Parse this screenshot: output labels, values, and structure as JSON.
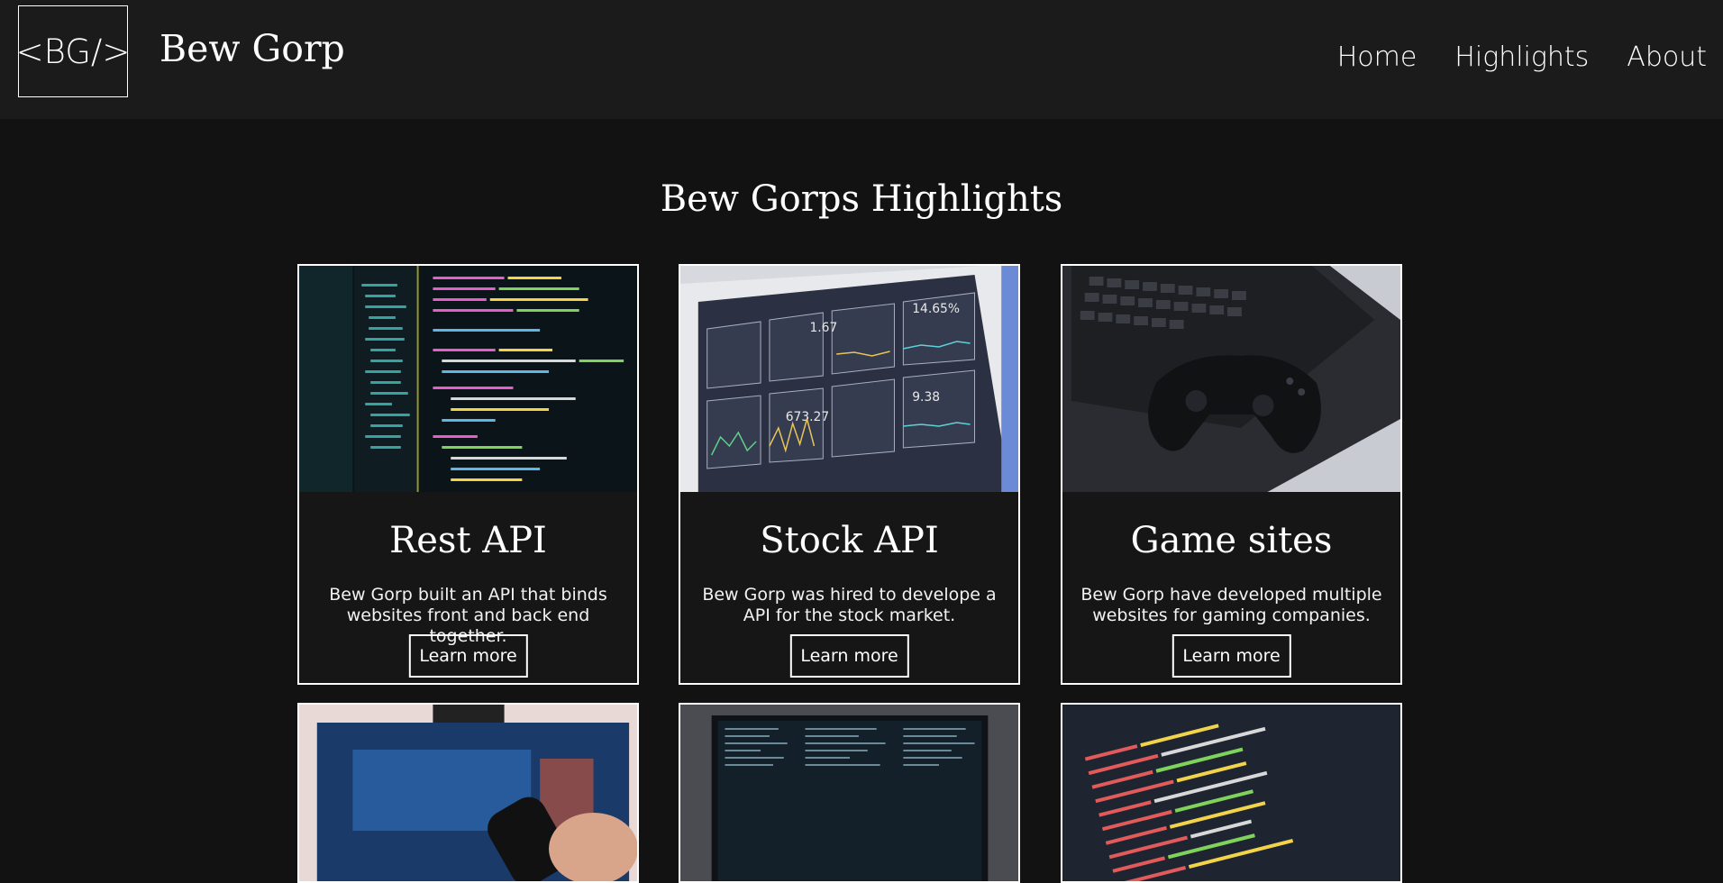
{
  "header": {
    "logo_text": "<BG/>",
    "brand": "Bew Gorp",
    "nav": [
      "Home",
      "Highlights",
      "About"
    ]
  },
  "main": {
    "title": "Bew Gorps Highlights",
    "cards": [
      {
        "title": "Rest API",
        "text": "Bew Gorp built an API that binds websites front and back end together.",
        "button": "Learn more"
      },
      {
        "title": "Stock API",
        "text": "Bew Gorp was hired to develope a API for the stock market.",
        "button": "Learn more"
      },
      {
        "title": "Game sites",
        "text": "Bew Gorp have developed multiple websites for gaming companies.",
        "button": "Learn more"
      }
    ]
  },
  "colors": {
    "background": "#121212",
    "navbar": "#1b1b1b",
    "text": "#ffffff",
    "border": "#ffffff"
  }
}
